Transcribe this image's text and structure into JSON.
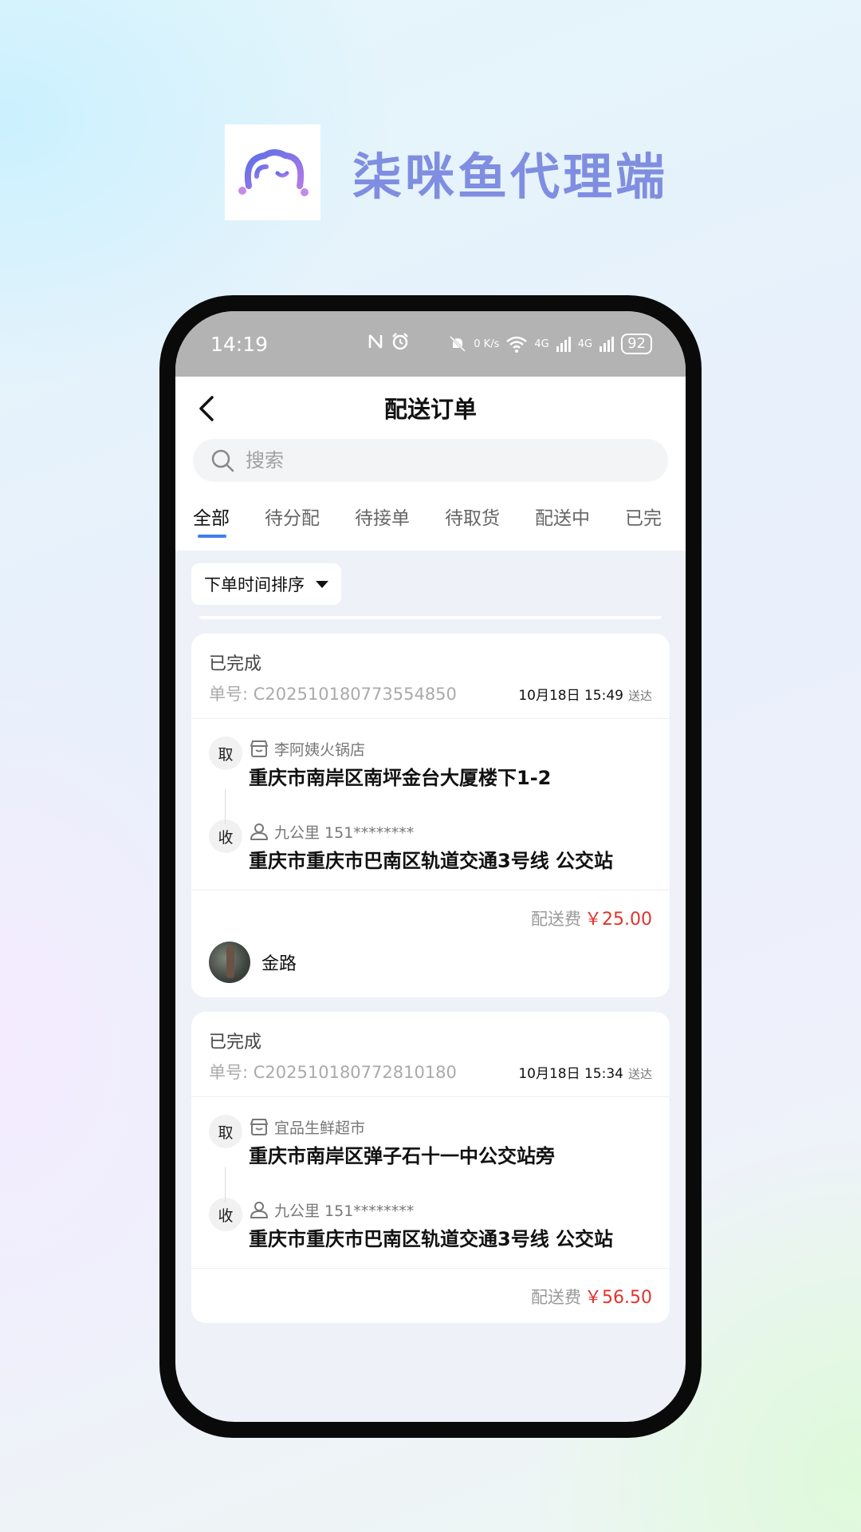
{
  "brand": {
    "title": "柒咪鱼代理端"
  },
  "status_bar": {
    "time": "14:19",
    "net_speed": "0 K/s",
    "signal_1": "4G",
    "signal_2": "4G",
    "battery": "92"
  },
  "nav": {
    "title": "配送订单"
  },
  "search": {
    "placeholder": "搜索"
  },
  "tabs": [
    "全部",
    "待分配",
    "待接单",
    "待取货",
    "配送中",
    "已完"
  ],
  "active_tab_index": 0,
  "sort": {
    "label": "下单时间排序"
  },
  "orders": [
    {
      "status": "已完成",
      "order_no": "单号: C202510180773554850",
      "time": "10月18日 15:49",
      "tag": "送达",
      "pickup": {
        "badge": "取",
        "shop": "李阿姨火锅店",
        "address": "重庆市南岸区南坪金台大厦楼下1-2"
      },
      "delivery": {
        "badge": "收",
        "contact": "九公里 151********",
        "address": "重庆市重庆市巴南区轨道交通3号线 公交站"
      },
      "fee_label": "配送费",
      "fee_amount": "￥25.00",
      "rider": "金路"
    },
    {
      "status": "已完成",
      "order_no": "单号: C202510180772810180",
      "time": "10月18日 15:34",
      "tag": "送达",
      "pickup": {
        "badge": "取",
        "shop": "宜品生鲜超市",
        "address": "重庆市南岸区弹子石十一中公交站旁"
      },
      "delivery": {
        "badge": "收",
        "contact": "九公里 151********",
        "address": "重庆市重庆市巴南区轨道交通3号线 公交站"
      },
      "fee_label": "配送费",
      "fee_amount": "￥56.50",
      "rider": ""
    }
  ],
  "colors": {
    "brand": "#7f8ee0",
    "tab_indicator": "#3d7ef2",
    "fee": "#e0332d"
  }
}
